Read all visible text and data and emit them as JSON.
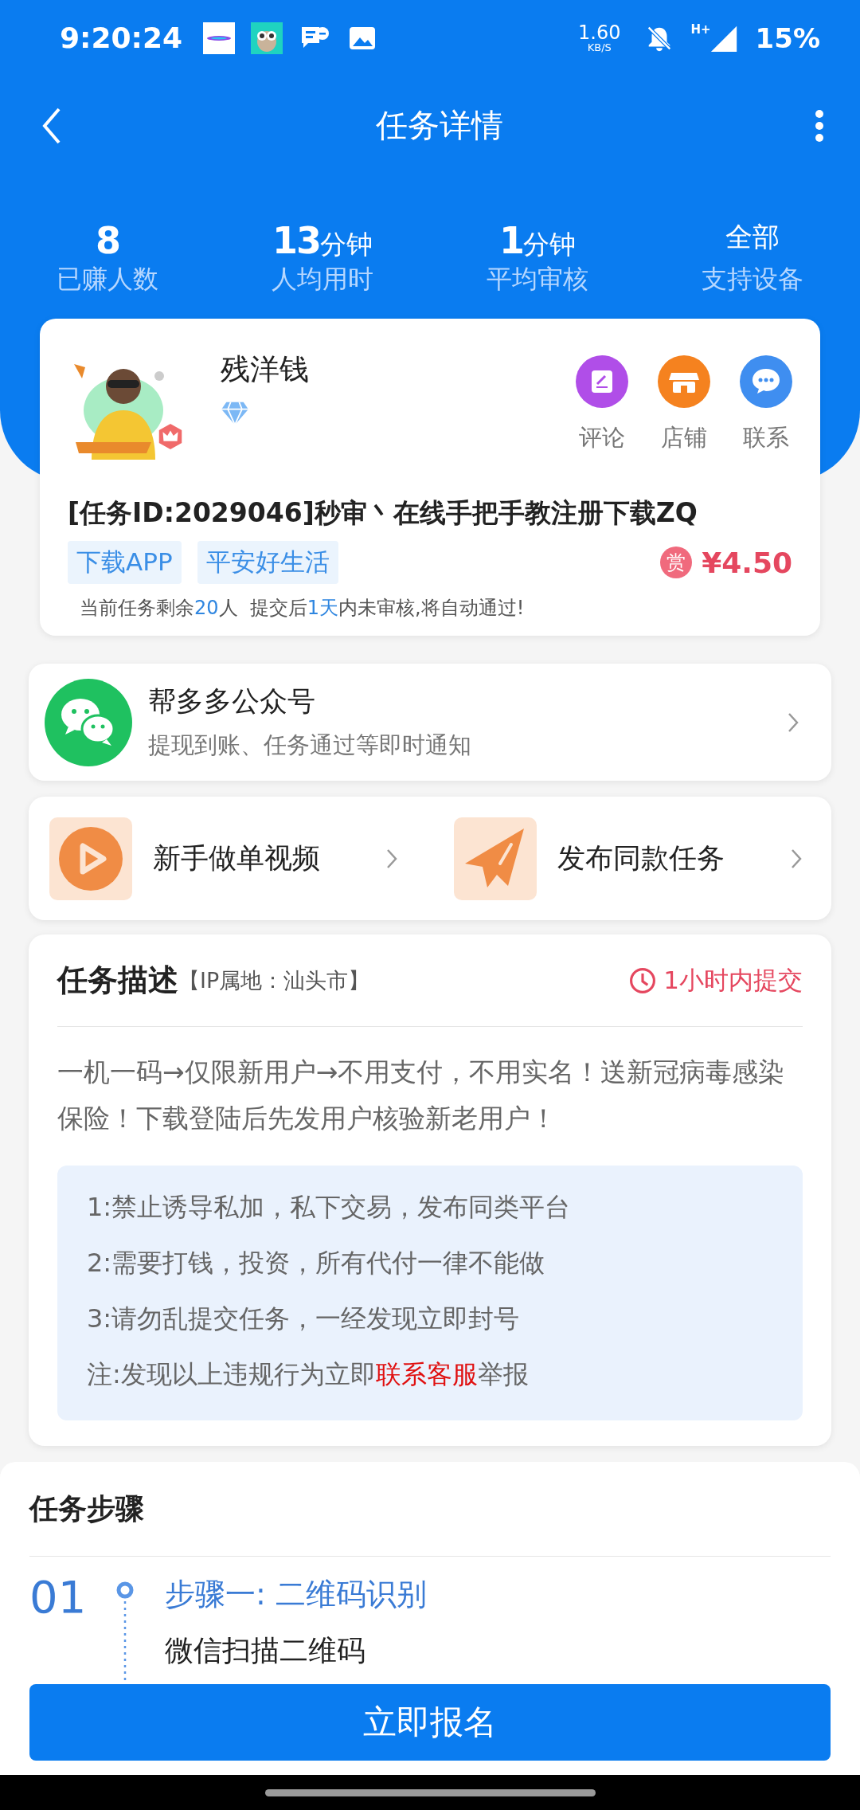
{
  "status_bar": {
    "time": "9:20:24",
    "speed": "1.60",
    "speed_unit": "KB/S",
    "network": "H+",
    "battery": "15%"
  },
  "nav": {
    "title": "任务详情"
  },
  "stats": [
    {
      "kind": "number",
      "value": "8",
      "label": "已赚人数"
    },
    {
      "kind": "number",
      "value": "13",
      "unit": "分钟",
      "label": "人均用时"
    },
    {
      "kind": "number",
      "value": "1",
      "unit": "分钟",
      "label": "平均审核"
    },
    {
      "kind": "text",
      "value": "全部",
      "label": "支持设备"
    }
  ],
  "publisher": {
    "name": "残洋钱",
    "actions": [
      {
        "label": "评论",
        "color": "#b04ee8"
      },
      {
        "label": "店铺",
        "color": "#f5821f"
      },
      {
        "label": "联系",
        "color": "#3f8ef0"
      }
    ]
  },
  "task": {
    "title": "[任务ID:2029046]秒审丶在线手把手教注册下载ZQ",
    "tags": [
      "下载APP",
      "平安好生活"
    ],
    "reward_badge": "赏",
    "reward": "¥4.50",
    "notice": [
      {
        "text": "当前任务剩余",
        "highlight": false
      },
      {
        "text": "20",
        "highlight": true
      },
      {
        "text": "人  提交后",
        "highlight": false
      },
      {
        "text": "1天",
        "highlight": true
      },
      {
        "text": "内未审核,将自动通过!",
        "highlight": false
      }
    ]
  },
  "wechat": {
    "title": "帮多多公众号",
    "subtitle": "提现到账、任务通过等即时通知"
  },
  "shortcuts": [
    {
      "label": "新手做单视频"
    },
    {
      "label": "发布同款任务"
    }
  ],
  "description": {
    "title": "任务描述",
    "ip": "【IP属地：汕头市】",
    "deadline": "1小时内提交",
    "text": "一机一码→仅限新用户→不用支付，不用实名！送新冠病毒感染保险！下载登陆后先发用户核验新老用户！",
    "rules": [
      [
        {
          "text": "1:禁止诱导私加，私下交易，发布同类平台",
          "highlight": false
        }
      ],
      [
        {
          "text": "2:需要打钱，投资，所有代付一律不能做",
          "highlight": false
        }
      ],
      [
        {
          "text": "3:请勿乱提交任务，一经发现立即封号",
          "highlight": false
        }
      ],
      [
        {
          "text": "注:发现以上违规行为立即",
          "highlight": false
        },
        {
          "text": "联系客服",
          "highlight": true
        },
        {
          "text": "举报",
          "highlight": false
        }
      ]
    ]
  },
  "steps": {
    "title": "任务步骤",
    "items": [
      {
        "number": "01",
        "title": "步骤一: 二维码识别",
        "detail": "微信扫描二维码"
      }
    ]
  },
  "button": "立即报名"
}
